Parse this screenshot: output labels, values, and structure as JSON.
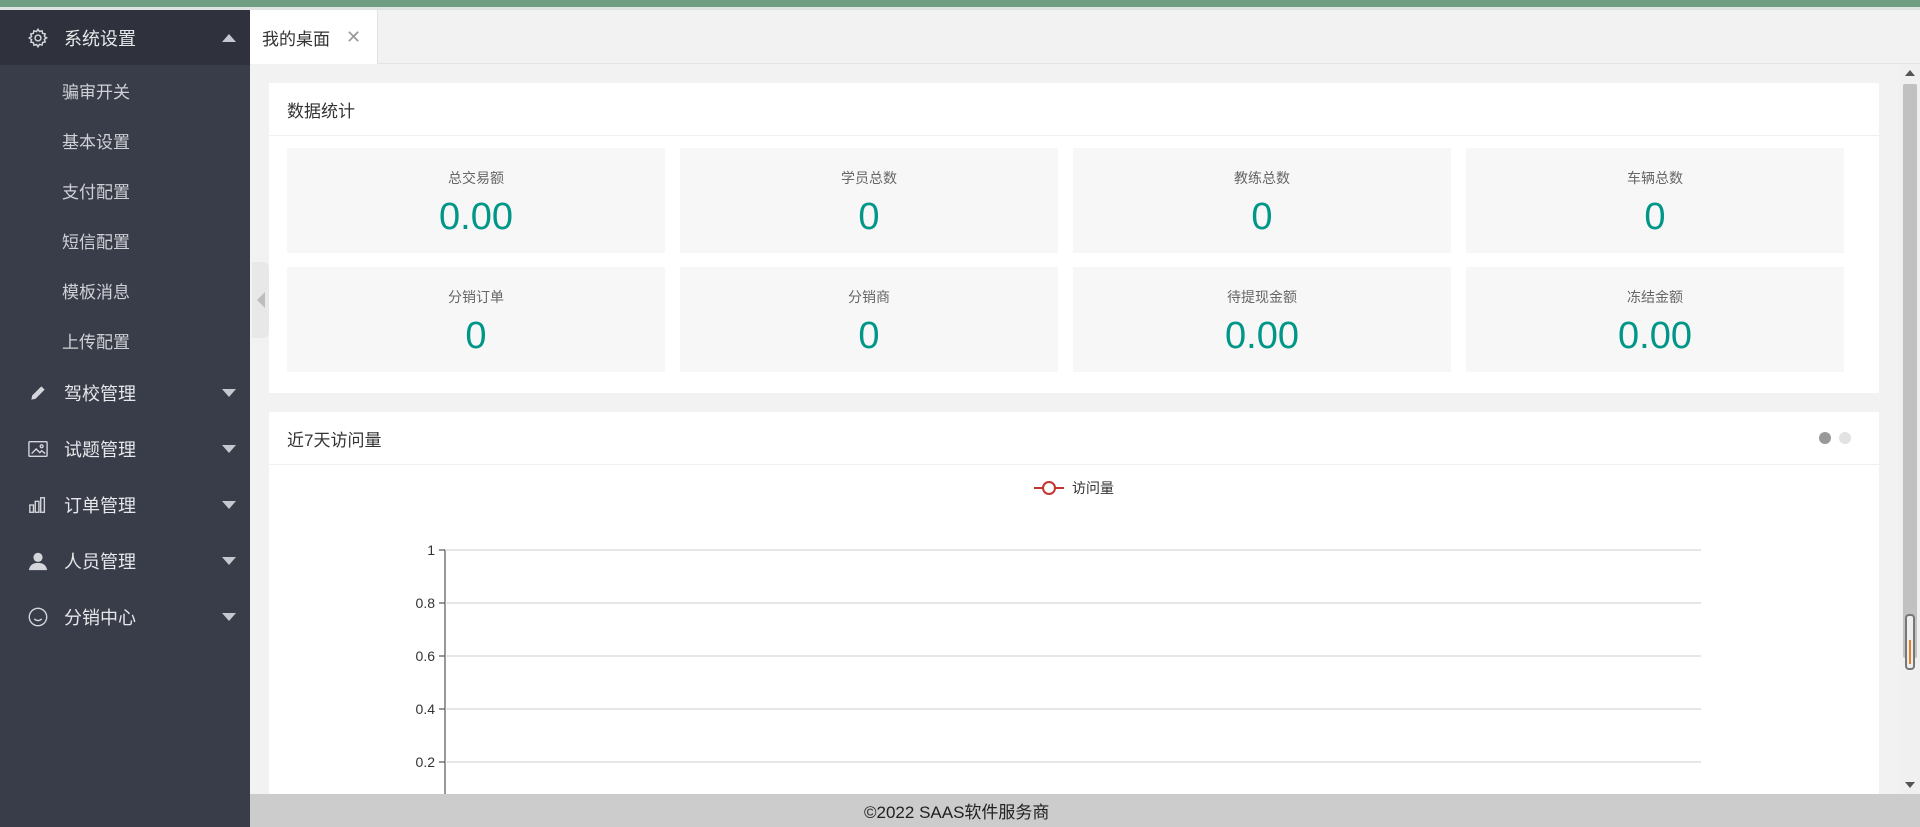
{
  "sidebar": {
    "groups": [
      {
        "label": "系统设置",
        "icon": "gear-icon",
        "expanded": true,
        "items": [
          "骗审开关",
          "基本设置",
          "支付配置",
          "短信配置",
          "模板消息",
          "上传配置"
        ]
      },
      {
        "label": "驾校管理",
        "icon": "pencil-icon",
        "expanded": false
      },
      {
        "label": "试题管理",
        "icon": "image-icon",
        "expanded": false
      },
      {
        "label": "订单管理",
        "icon": "chart-icon",
        "expanded": false
      },
      {
        "label": "人员管理",
        "icon": "user-icon",
        "expanded": false
      },
      {
        "label": "分销中心",
        "icon": "smile-icon",
        "expanded": false
      }
    ]
  },
  "tabs": [
    {
      "label": "我的桌面",
      "close": "✕"
    }
  ],
  "stats_card": {
    "title": "数据统计",
    "items": [
      {
        "label": "总交易额",
        "value": "0.00"
      },
      {
        "label": "学员总数",
        "value": "0"
      },
      {
        "label": "教练总数",
        "value": "0"
      },
      {
        "label": "车辆总数",
        "value": "0"
      },
      {
        "label": "分销订单",
        "value": "0"
      },
      {
        "label": "分销商",
        "value": "0"
      },
      {
        "label": "待提现金额",
        "value": "0.00"
      },
      {
        "label": "冻结金额",
        "value": "0.00"
      }
    ]
  },
  "visits_card": {
    "title": "近7天访问量",
    "carousel_active": 0
  },
  "chart_data": {
    "type": "line",
    "title": "",
    "series": [
      {
        "name": "访问量",
        "values": []
      }
    ],
    "ylim": [
      0,
      1
    ],
    "yticks": [
      "1",
      "0.8",
      "0.6",
      "0.4",
      "0.2"
    ],
    "grid": true,
    "legend": "top-center",
    "series_color": "#c23531"
  },
  "footer": {
    "text": "©2022 SAAS软件服务商"
  },
  "colors": {
    "sidebar": "#393d49",
    "accent": "#009688",
    "top_strip": "#6f9e82"
  }
}
